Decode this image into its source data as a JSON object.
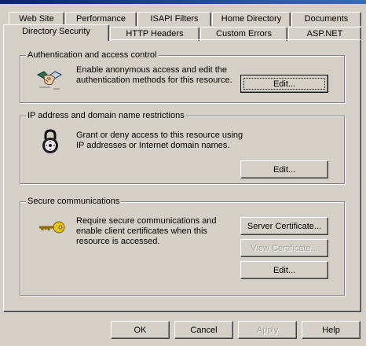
{
  "tabs_row1": [
    "Web Site",
    "Performance",
    "ISAPI Filters",
    "Home Directory",
    "Documents"
  ],
  "tabs_row2": [
    "Directory Security",
    "HTTP Headers",
    "Custom Errors",
    "ASP.NET"
  ],
  "auth": {
    "title": "Authentication and access control",
    "description": "Enable anonymous access and edit the authentication methods for this resource.",
    "edit_label": "Edit..."
  },
  "ip": {
    "title": "IP address and domain name restrictions",
    "description": "Grant or deny access to this resource using IP addresses or Internet domain names.",
    "edit_label": "Edit..."
  },
  "secure": {
    "title": "Secure communications",
    "description": "Require secure communications and enable client certificates when this resource is accessed.",
    "server_cert_label": "Server Certificate...",
    "view_cert_label": "View Certificate...",
    "edit_label": "Edit..."
  },
  "footer": {
    "ok_label": "OK",
    "cancel_label": "Cancel",
    "apply_label": "Apply",
    "help_label": "Help"
  },
  "icons": {
    "auth": "handshake-icon",
    "ip": "padlock-icon",
    "secure": "key-icon"
  }
}
